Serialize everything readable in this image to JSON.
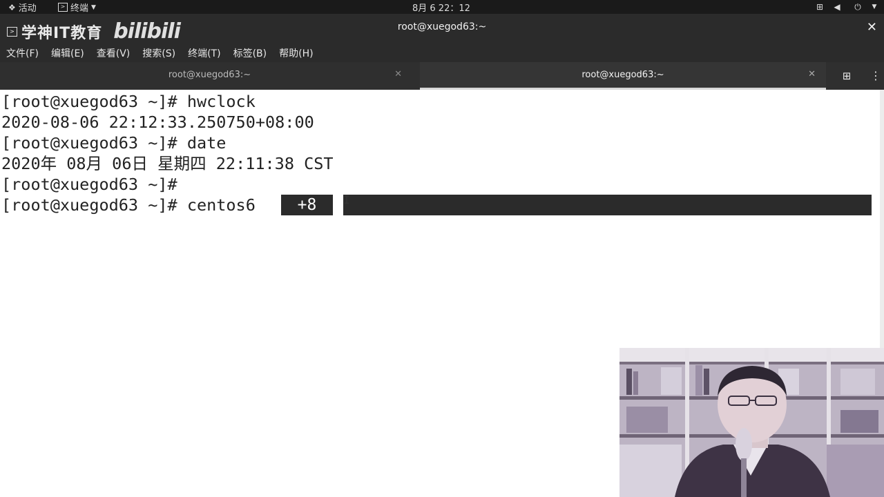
{
  "topbar": {
    "activities": "活动",
    "app_menu": "终端",
    "clock": "8月 6  22：12"
  },
  "titlebar": {
    "brand": "学神IT教育",
    "bilibili": "bilibili",
    "title": "root@xuegod63:~",
    "close": "✕"
  },
  "menubar": [
    {
      "label": "文件(F)"
    },
    {
      "label": "编辑(E)"
    },
    {
      "label": "查看(V)"
    },
    {
      "label": "搜索(S)"
    },
    {
      "label": "终端(T)"
    },
    {
      "label": "标签(B)"
    },
    {
      "label": "帮助(H)"
    }
  ],
  "tabs": [
    {
      "label": "root@xuegod63:~",
      "active": false
    },
    {
      "label": "root@xuegod63:~",
      "active": true
    }
  ],
  "terminal": {
    "lines": [
      "[root@xuegod63 ~]# hwclock",
      "2020-08-06 22:12:33.250750+08:00",
      "[root@xuegod63 ~]# date",
      "2020年 08月 06日 星期四 22:11:38 CST",
      "[root@xuegod63 ~]#",
      "[root@xuegod63 ~]# centos6"
    ],
    "highlight_badge": "+8"
  },
  "colors": {
    "titlebar": "#2b2b2b",
    "topbar": "#1a1a1a",
    "terminal_bg": "#ffffff",
    "terminal_fg": "#222222"
  }
}
